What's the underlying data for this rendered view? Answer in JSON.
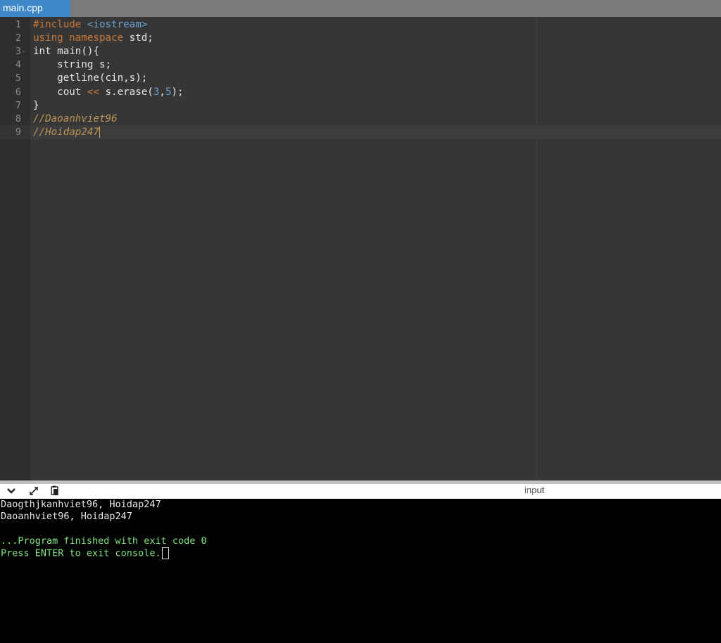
{
  "tab": {
    "filename": "main.cpp"
  },
  "editor": {
    "line_numbers": [
      "1",
      "2",
      "3",
      "4",
      "5",
      "6",
      "7",
      "8",
      "9"
    ],
    "fold_marker": "-",
    "code": {
      "l1_directive": "#include",
      "l1_header": " <iostream>",
      "l2_using": "using",
      "l2_namespace": " namespace",
      "l2_rest": " std;",
      "l3": "int main(){",
      "l4": "    string s;",
      "l5": "    getline(cin,s);",
      "l6_a": "    cout ",
      "l6_op": "<<",
      "l6_b": " s.erase(",
      "l6_n1": "3",
      "l6_comma": ",",
      "l6_n2": "5",
      "l6_end": ");",
      "l7": "}",
      "l8": "//Daoanhviet96",
      "l9": "//Hoidap247"
    }
  },
  "console_bar": {
    "collapse_icon": "chevron-down-icon",
    "expand_icon": "expand-icon",
    "copy_icon": "copy-icon",
    "input_label": "input"
  },
  "console": {
    "lines": [
      "Daogthjkanhviet96, Hoidap247",
      "Daoanhviet96, Hoidap247",
      "",
      "...Program finished with exit code 0",
      "Press ENTER to exit console."
    ]
  },
  "colors": {
    "tab_active": "#3d89c8",
    "editor_bg": "#363636",
    "keyword": "#cc7833",
    "number": "#6a9ed0",
    "comment": "#bc9458",
    "console_status": "#7fe37f"
  }
}
